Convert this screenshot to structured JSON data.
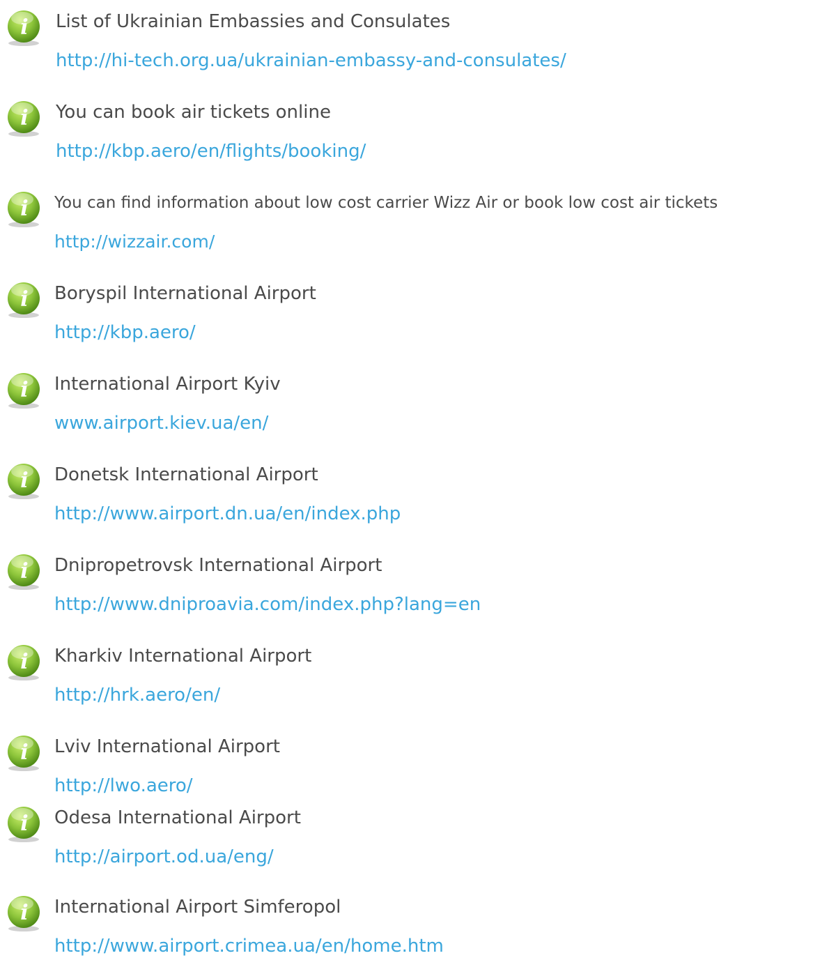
{
  "colors": {
    "title_text": "#4a4a4a",
    "link_text": "#3aa6dc",
    "icon_green_light": "#b6e055",
    "icon_green_dark": "#4f8a16",
    "icon_letter": "#ffffff"
  },
  "icon_name": "info-icon",
  "icon_glyph": "i",
  "items": [
    {
      "title": "List of Ukrainian Embassies and Consulates",
      "url": "http://hi-tech.org.ua/ukrainian-embassy-and-consulates/"
    },
    {
      "title": "You can book air tickets online",
      "url": "http://kbp.aero/en/flights/booking/"
    },
    {
      "title": "You can find information about low cost carrier Wizz Air or book low cost air tickets",
      "url": "http://wizzair.com/"
    },
    {
      "title": "Boryspil International Airport",
      "url": "http://kbp.aero/"
    },
    {
      "title": "International Airport Kyiv",
      "url": "www.airport.kiev.ua/en/"
    },
    {
      "title": "Donetsk International Airport",
      "url": "http://www.airport.dn.ua/en/index.php"
    },
    {
      "title": "Dnipropetrovsk International Airport",
      "url": "http://www.dniproavia.com/index.php?lang=en"
    },
    {
      "title": "Kharkiv International Airport",
      "url": "http://hrk.aero/en/"
    },
    {
      "title": "Lviv International Airport",
      "url": "http://lwo.aero/"
    },
    {
      "title": "Odesa International Airport",
      "url": "http://airport.od.ua/eng/"
    },
    {
      "title": "International Airport Simferopol",
      "url": "http://www.airport.crimea.ua/en/home.htm"
    }
  ]
}
